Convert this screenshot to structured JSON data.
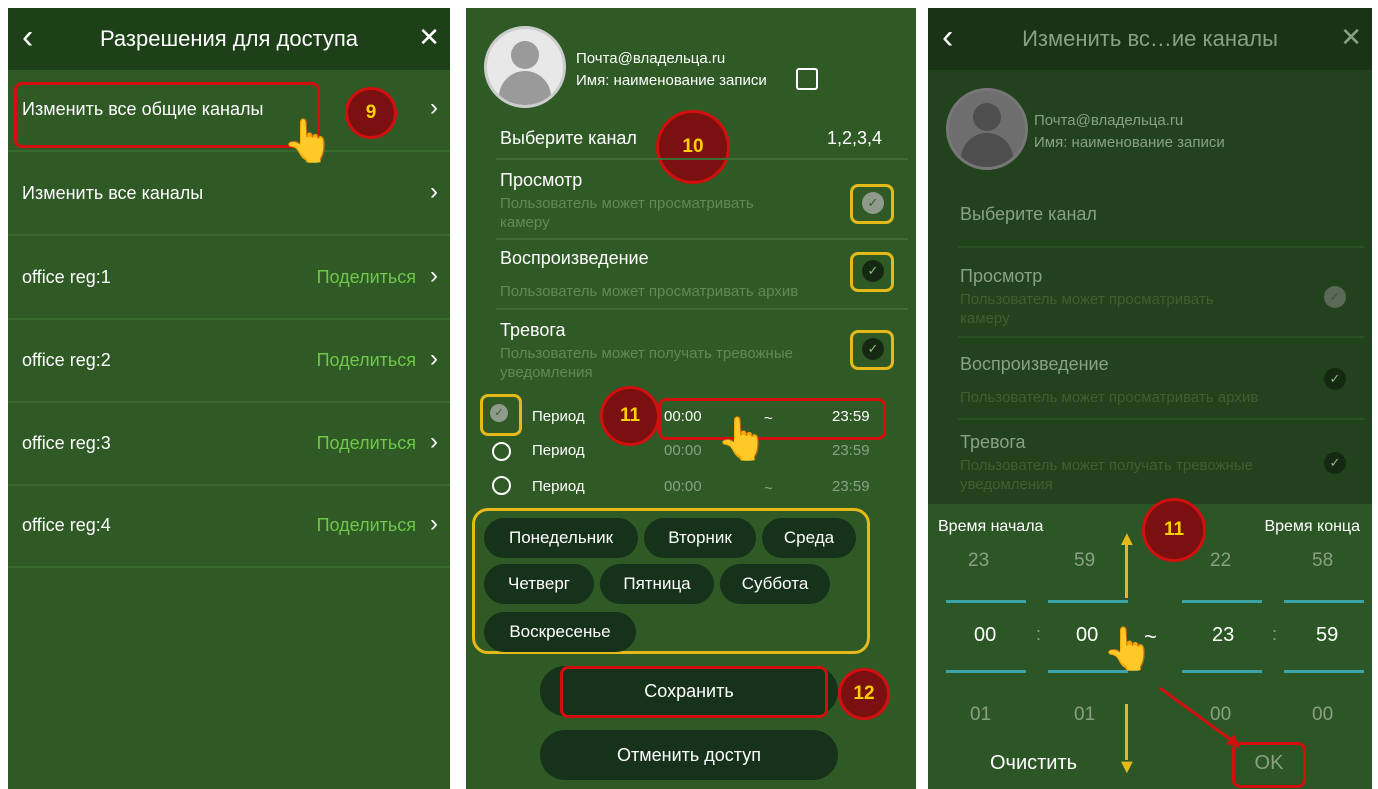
{
  "panel1": {
    "title": "Разрешения для доступа",
    "back_icon": "‹",
    "close_icon": "✕",
    "rows": [
      {
        "label": "Изменить все общие каналы",
        "action": ""
      },
      {
        "label": "Изменить все каналы",
        "action": ""
      },
      {
        "label": "office reg:1",
        "action": "Поделиться"
      },
      {
        "label": "office reg:2",
        "action": "Поделиться"
      },
      {
        "label": "office reg:3",
        "action": "Поделиться"
      },
      {
        "label": "office reg:4",
        "action": "Поделиться"
      }
    ],
    "step": "9"
  },
  "panel2": {
    "email": "Почта@владельца.ru",
    "name": "Имя: наименование записи",
    "select_channel": "Выберите канал",
    "channels": "1,2,3,4",
    "step_channel": "10",
    "perms": [
      {
        "title": "Просмотр",
        "sub": "Пользователь может просматривать камеру",
        "state": "gray"
      },
      {
        "title": "Воспроизведение",
        "sub": "Пользователь может просматривать архив",
        "state": "dark"
      },
      {
        "title": "Тревога",
        "sub": "Пользователь может получать тревожные уведомления",
        "state": "dark"
      }
    ],
    "periods": [
      {
        "label": "Период",
        "start": "00:00",
        "sep": "~",
        "end": "23:59",
        "checked": true
      },
      {
        "label": "Период",
        "start": "00:00",
        "sep": "~",
        "end": "23:59",
        "checked": false
      },
      {
        "label": "Период",
        "start": "00:00",
        "sep": "~",
        "end": "23:59",
        "checked": false
      }
    ],
    "step_period": "11",
    "days": [
      "Понедельник",
      "Вторник",
      "Среда",
      "Четверг",
      "Пятница",
      "Суббота",
      "Воскресенье"
    ],
    "save": "Сохранить",
    "step_save": "12",
    "revoke": "Отменить доступ"
  },
  "panel3": {
    "title": "Изменить вс…ие каналы",
    "email": "Почта@владельца.ru",
    "name": "Имя: наименование записи",
    "select_channel": "Выберите канал",
    "perms": [
      {
        "title": "Просмотр",
        "sub": "Пользователь может просматривать камеру"
      },
      {
        "title": "Воспроизведение",
        "sub": "Пользователь может просматривать архив"
      },
      {
        "title": "Тревога",
        "sub": "Пользователь может получать тревожные уведомления"
      }
    ],
    "start_label": "Время начала",
    "end_label": "Время конца",
    "step": "11",
    "wheel_top": [
      "23",
      "59",
      "22",
      "58"
    ],
    "wheel_mid": [
      "00",
      ":",
      "00",
      "~",
      "23",
      ":",
      "59"
    ],
    "wheel_bot": [
      "01",
      "01",
      "00",
      "00"
    ],
    "clear": "Очистить",
    "ok": "OK"
  }
}
